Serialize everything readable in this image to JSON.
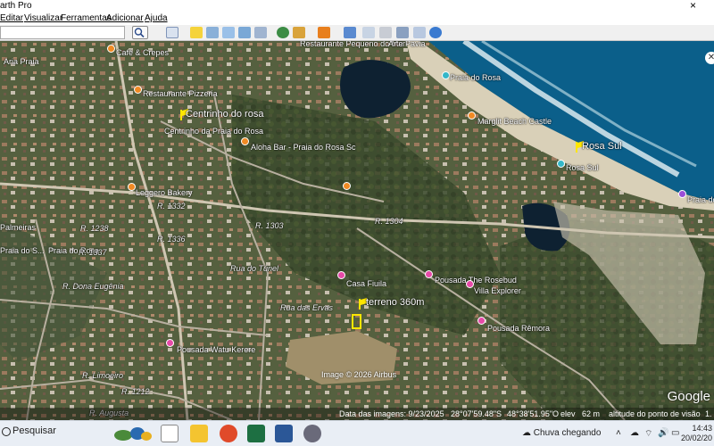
{
  "window": {
    "title": "arth Pro",
    "close": "×"
  },
  "menu": [
    "Editar",
    "Visualizar",
    "Ferramentas",
    "Adicionar",
    "Ajuda"
  ],
  "map": {
    "top_labels": [
      "Rosa Ecologia",
      "Restaurante Pequeno do Mar",
      "Arte Pavia"
    ],
    "places": [
      {
        "id": "cafe",
        "text": "Café & Crepes"
      },
      {
        "id": "restaurante",
        "text": "Restaurante Pizzeria"
      },
      {
        "id": "centrinho",
        "text": "Centrinho do rosa"
      },
      {
        "id": "centrinho2",
        "text": "Centrinho da Praia do Rosa"
      },
      {
        "id": "aloha",
        "text": "Aloha Bar - Praia do Rosa Sc"
      },
      {
        "id": "leggero",
        "text": "Leggero Bakery"
      },
      {
        "id": "praiarosa",
        "text": "Praia do Rosa"
      },
      {
        "id": "marglit",
        "text": "Marglit Beach Castle"
      },
      {
        "id": "rosasul",
        "text": "Rosa Sul"
      },
      {
        "id": "rosasul2",
        "text": "Rosa Sul"
      },
      {
        "id": "praiadorosa2",
        "text": "Praia do Rosa"
      },
      {
        "id": "casafiuila",
        "text": "Casa Fiuila"
      },
      {
        "id": "pousadarosebud",
        "text": "Pousada The Rosebud"
      },
      {
        "id": "villaexplorer",
        "text": "Villa Explorer"
      },
      {
        "id": "terreno",
        "text": "terreno 360m"
      },
      {
        "id": "remora",
        "text": "Pousada Rêmora"
      },
      {
        "id": "watu",
        "text": "Pousada Watu Kerere"
      },
      {
        "id": "palmeiras",
        "text": "Palmeiras"
      },
      {
        "id": "praiarosa3",
        "text": "Praia do Rosa"
      },
      {
        "id": "praiasul",
        "text": "Praia do S..."
      },
      {
        "id": "aria",
        "text": "Aria Praia"
      }
    ],
    "roads": [
      {
        "id": "r1332",
        "text": "R. 1332"
      },
      {
        "id": "r1303",
        "text": "R. 1303"
      },
      {
        "id": "r1304",
        "text": "R. 1304"
      },
      {
        "id": "r1238",
        "text": "R. 1238"
      },
      {
        "id": "r1336",
        "text": "R. 1336"
      },
      {
        "id": "r1337",
        "text": "R. 1337"
      },
      {
        "id": "r1212",
        "text": "R. 1212"
      },
      {
        "id": "eugenia",
        "text": "R. Dona Eugênia"
      },
      {
        "id": "limoeiro",
        "text": "R. Limoeiro"
      },
      {
        "id": "augusta",
        "text": "R. Augusta"
      },
      {
        "id": "tunel",
        "text": "Rua do Túnel"
      },
      {
        "id": "ervas",
        "text": "Rua das Ervas"
      }
    ],
    "image_credit": "Image © 2026 Airbus",
    "google": "Google"
  },
  "status": {
    "date": "Data das imagens: 9/23/2025",
    "lat": "28°07'59.48\"S",
    "lon": "48°38'51.95\"O",
    "elev": "elev",
    "elev_value": "62 m",
    "alt": "altitude do ponto de visão",
    "alt_value": "1."
  },
  "taskbar": {
    "search": "Pesquisar",
    "weather": "Chuva chegando",
    "time": "14:43",
    "date": "20/02/20"
  },
  "colors": {
    "ocean": "#0b5f8a",
    "sand": "#d9d0b8",
    "lagoon": "#0e2131",
    "vegetation": "#4d5a3d",
    "accent": "#ffe600"
  }
}
